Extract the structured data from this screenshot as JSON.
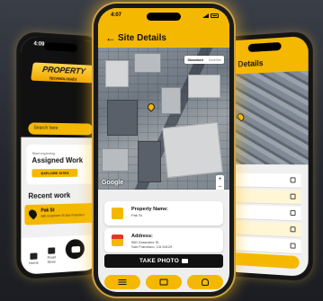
{
  "colors": {
    "accent": "#f5b800",
    "dark": "#111111"
  },
  "left_phone": {
    "time": "4:09",
    "logo": "PROPERTY",
    "logo_sub": "TECHNOLOGIES",
    "search_placeholder": "Search here",
    "card_small": "Start exploring",
    "card_title": "Assigned Work",
    "card_button": "EXPLORE SITES",
    "recent_title": "Recent work",
    "recent_item_name": "Pak St",
    "recent_item_address": "980 Grasmere St San Francisco",
    "nav_home": "Home",
    "nav_search": "Road Stree",
    "icons": [
      "pin-icon",
      "home-icon",
      "search-icon",
      "camera-icon"
    ]
  },
  "center_phone": {
    "time": "4:07",
    "header_title": "Site Details",
    "map_standard": "Standard",
    "map_satellite": "Satellite",
    "zoom_in": "+",
    "zoom_out": "−",
    "map_attribution": "Google",
    "property_label": "Property Name:",
    "property_value": "Pak St",
    "address_label": "Address:",
    "address_line1": "980 Grasmere St",
    "address_line2": "San Francisco, CA 94129",
    "take_photo": "TAKE PHOTO",
    "icons": [
      "back-arrow-icon",
      "map-pin-icon",
      "building-icon",
      "store-icon",
      "camera-icon",
      "list-icon",
      "gallery-icon",
      "pan-icon"
    ]
  },
  "right_phone": {
    "header_title": "Details",
    "icons": [
      "edit-icon",
      "map-pin-icon"
    ]
  }
}
